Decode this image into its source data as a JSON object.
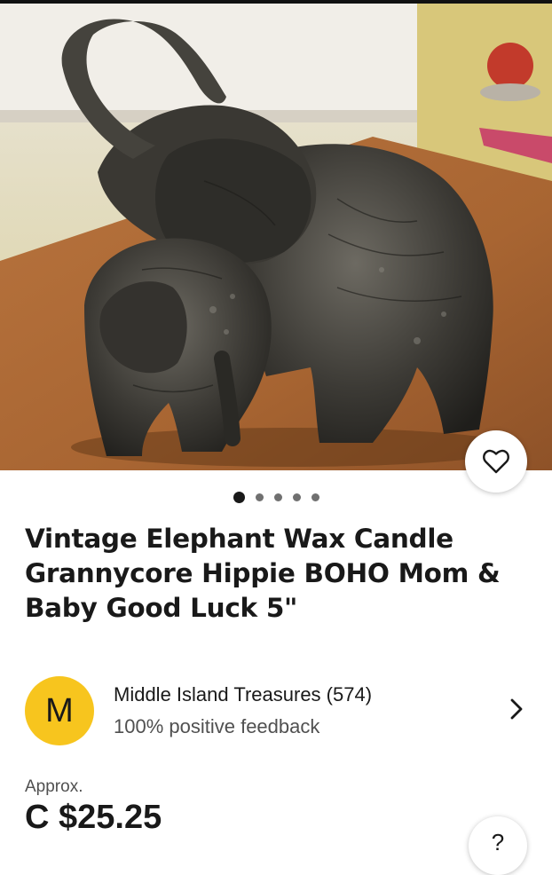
{
  "listing": {
    "title": "Vintage Elephant Wax Candle Grannycore Hippie BOHO Mom & Baby Good Luck 5\"",
    "image_count": 5,
    "active_image_index": 0
  },
  "seller": {
    "initial": "M",
    "name_with_score": "Middle Island Treasures (574)",
    "feedback": "100% positive feedback"
  },
  "price": {
    "approx_label": "Approx.",
    "value": "C $25.25"
  },
  "help": {
    "label": "?"
  },
  "icons": {
    "favorite": "heart-outline-icon",
    "seller_link": "chevron-right-icon"
  },
  "colors": {
    "avatar_bg": "#f7c51e",
    "text_primary": "#191919",
    "text_secondary": "#505050"
  }
}
